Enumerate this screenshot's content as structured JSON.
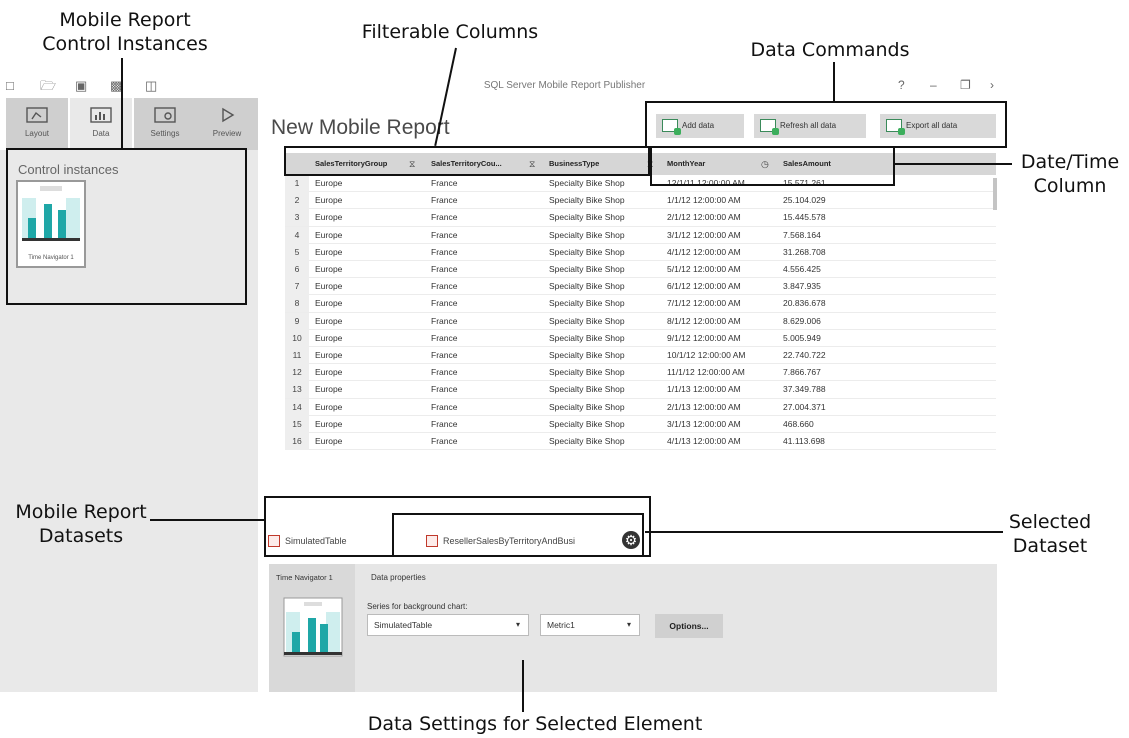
{
  "app": {
    "title": "SQL Server Mobile Report Publisher",
    "help": "?"
  },
  "nav_tabs": [
    {
      "label": "Layout"
    },
    {
      "label": "Data"
    },
    {
      "label": "Settings"
    },
    {
      "label": "Preview"
    }
  ],
  "left_panel": {
    "title": "Control instances",
    "instance": {
      "label": "Time Navigator 1"
    }
  },
  "report": {
    "title": "New Mobile Report"
  },
  "commands": {
    "add": "Add data",
    "refresh": "Refresh all data",
    "export": "Export all data"
  },
  "table": {
    "headers": [
      "SalesTerritoryGroup",
      "SalesTerritoryCou...",
      "BusinessType",
      "MonthYear",
      "SalesAmount"
    ],
    "rows": [
      [
        "1",
        "Europe",
        "France",
        "Specialty Bike Shop",
        "12/1/11 12:00:00 AM",
        "15.571.261"
      ],
      [
        "2",
        "Europe",
        "France",
        "Specialty Bike Shop",
        "1/1/12 12:00:00 AM",
        "25.104.029"
      ],
      [
        "3",
        "Europe",
        "France",
        "Specialty Bike Shop",
        "2/1/12 12:00:00 AM",
        "15.445.578"
      ],
      [
        "4",
        "Europe",
        "France",
        "Specialty Bike Shop",
        "3/1/12 12:00:00 AM",
        "7.568.164"
      ],
      [
        "5",
        "Europe",
        "France",
        "Specialty Bike Shop",
        "4/1/12 12:00:00 AM",
        "31.268.708"
      ],
      [
        "6",
        "Europe",
        "France",
        "Specialty Bike Shop",
        "5/1/12 12:00:00 AM",
        "4.556.425"
      ],
      [
        "7",
        "Europe",
        "France",
        "Specialty Bike Shop",
        "6/1/12 12:00:00 AM",
        "3.847.935"
      ],
      [
        "8",
        "Europe",
        "France",
        "Specialty Bike Shop",
        "7/1/12 12:00:00 AM",
        "20.836.678"
      ],
      [
        "9",
        "Europe",
        "France",
        "Specialty Bike Shop",
        "8/1/12 12:00:00 AM",
        "8.629.006"
      ],
      [
        "10",
        "Europe",
        "France",
        "Specialty Bike Shop",
        "9/1/12 12:00:00 AM",
        "5.005.949"
      ],
      [
        "11",
        "Europe",
        "France",
        "Specialty Bike Shop",
        "10/1/12 12:00:00 AM",
        "22.740.722"
      ],
      [
        "12",
        "Europe",
        "France",
        "Specialty Bike Shop",
        "11/1/12 12:00:00 AM",
        "7.866.767"
      ],
      [
        "13",
        "Europe",
        "France",
        "Specialty Bike Shop",
        "1/1/13 12:00:00 AM",
        "37.349.788"
      ],
      [
        "14",
        "Europe",
        "France",
        "Specialty Bike Shop",
        "2/1/13 12:00:00 AM",
        "27.004.371"
      ],
      [
        "15",
        "Europe",
        "France",
        "Specialty Bike Shop",
        "3/1/13 12:00:00 AM",
        "468.660"
      ],
      [
        "16",
        "Europe",
        "France",
        "Specialty Bike Shop",
        "4/1/13 12:00:00 AM",
        "41.113.698"
      ]
    ]
  },
  "datasets": [
    {
      "name": "SimulatedTable"
    },
    {
      "name": "ResellerSalesByTerritoryAndBusi"
    }
  ],
  "data_properties": {
    "element": "Time Navigator 1",
    "heading": "Data properties",
    "series_label": "Series for background chart:",
    "series_value": "SimulatedTable",
    "metric_value": "Metric1",
    "options_label": "Options..."
  },
  "callouts": {
    "control_instances": [
      "Mobile Report",
      "Control Instances"
    ],
    "filterable": "Filterable Columns",
    "commands": "Data Commands",
    "datetime": [
      "Date/Time",
      "Column"
    ],
    "datasets": [
      "Mobile Report",
      "Datasets"
    ],
    "selected": [
      "Selected",
      "Dataset"
    ],
    "settings": "Data Settings for Selected Element"
  }
}
